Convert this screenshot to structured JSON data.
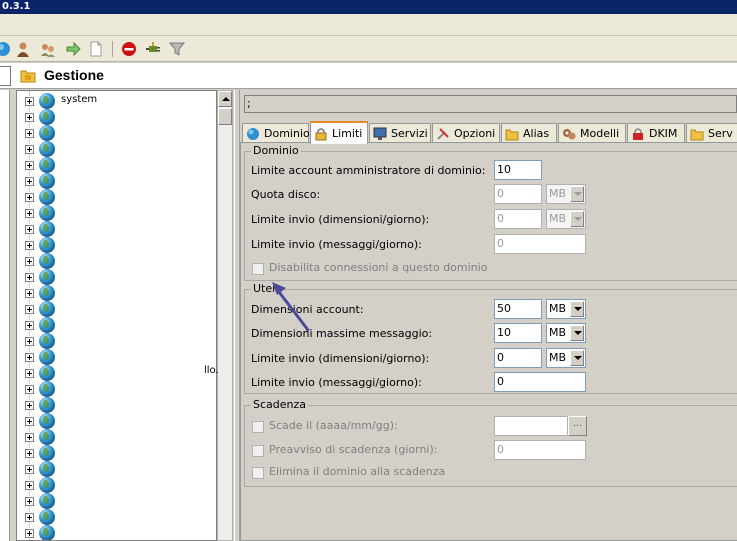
{
  "window": {
    "title": "0.3.1"
  },
  "toolbar": {
    "icons": [
      "globe-icon",
      "user-icon",
      "users-icon",
      "arrow-right-icon",
      "document-icon",
      "stop-icon",
      "plug-icon",
      "filter-icon"
    ],
    "colors": {
      "stop": "#cc1111",
      "accent": "#e68b2c"
    }
  },
  "header": {
    "title": "Gestione"
  },
  "tree": {
    "first_label": "system",
    "row_count": 28,
    "stray_text": "llo."
  },
  "right": {
    "path_value": ";",
    "tabs": [
      {
        "label": "Dominio",
        "icon": "globe-icon"
      },
      {
        "label": "Limiti",
        "icon": "lock-icon",
        "active": true
      },
      {
        "label": "Servizi",
        "icon": "monitor-icon"
      },
      {
        "label": "Opzioni",
        "icon": "tools-icon"
      },
      {
        "label": "Alias",
        "icon": "folder-lock-icon"
      },
      {
        "label": "Modelli",
        "icon": "gears-icon"
      },
      {
        "label": "DKIM",
        "icon": "padlock-icon"
      },
      {
        "label": "Serv",
        "icon": "folder-icon"
      }
    ]
  },
  "limiti": {
    "dominio": {
      "legend": "Dominio",
      "admin_limit": {
        "label": "Limite account amministratore di dominio:",
        "value": "10"
      },
      "quota": {
        "label": "Quota disco:",
        "value": "0",
        "unit": "MB"
      },
      "send_size": {
        "label": "Limite invio (dimensioni/giorno):",
        "value": "0",
        "unit": "MB"
      },
      "send_count": {
        "label": "Limite invio (messaggi/giorno):",
        "value": "0"
      },
      "disable_conn": {
        "label": "Disabilita connessioni a questo dominio"
      }
    },
    "utenti": {
      "legend": "Uten",
      "account_size": {
        "label": "Dimensioni account:",
        "value": "50",
        "unit": "MB"
      },
      "max_msg": {
        "label": "Dimensioni massime messaggio:",
        "value": "10",
        "unit": "MB"
      },
      "send_size": {
        "label": "Limite invio (dimensioni/giorno):",
        "value": "0",
        "unit": "MB"
      },
      "send_count": {
        "label": "Limite invio (messaggi/giorno):",
        "value": "0"
      }
    },
    "scadenza": {
      "legend": "Scadenza",
      "expires": {
        "label": "Scade il (aaaa/mm/gg):",
        "value": "",
        "browse": "..."
      },
      "notice": {
        "label": "Preavviso di scadenza (giorni):",
        "value": "0"
      },
      "delete": {
        "label": "Elimina il dominio alla scadenza"
      }
    }
  }
}
